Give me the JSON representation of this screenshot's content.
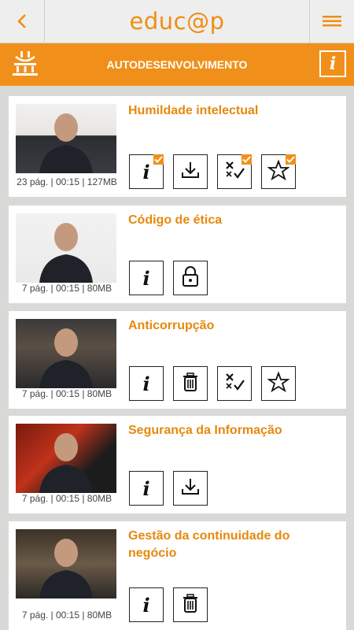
{
  "app": {
    "logo_text": "educ@p"
  },
  "header": {
    "section_title": "AUTODESENVOLVIMENTO"
  },
  "colors": {
    "accent": "#f0901a",
    "title": "#e5890d"
  },
  "courses": [
    {
      "title": "Humildade intelectual",
      "meta": "23 pág. | 00:15 | 127MB",
      "buttons": [
        "info-icon",
        "download-icon",
        "quiz-icon",
        "star-icon"
      ],
      "checked": [
        "info-icon",
        "quiz-icon",
        "star-icon"
      ]
    },
    {
      "title": "Código de ética",
      "meta": "7 pág. | 00:15 | 80MB",
      "buttons": [
        "info-icon",
        "lock-icon"
      ],
      "checked": []
    },
    {
      "title": "Anticorrupção",
      "meta": "7 pág. | 00:15 | 80MB",
      "buttons": [
        "info-icon",
        "trash-icon",
        "quiz-icon",
        "star-icon"
      ],
      "checked": []
    },
    {
      "title": "Segurança da Informação",
      "meta": "7 pág. | 00:15 | 80MB",
      "buttons": [
        "info-icon",
        "download-icon"
      ],
      "checked": []
    },
    {
      "title": "Gestão da continuidade do negócio",
      "meta": "7 pág. | 00:15 | 80MB",
      "buttons": [
        "info-icon",
        "trash-icon"
      ],
      "checked": []
    }
  ]
}
